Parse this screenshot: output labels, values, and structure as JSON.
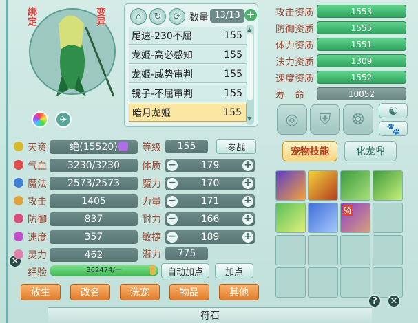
{
  "portrait": {
    "tag_left": "绑定",
    "tag_right": "变异"
  },
  "toolbar": {
    "count_label": "数量",
    "count_value": "13/13",
    "add": "+"
  },
  "pet_list": [
    {
      "name": "尾速-230不屈",
      "level": "155"
    },
    {
      "name": "龙姬-高必感知",
      "level": "155"
    },
    {
      "name": "龙姬-威势审判",
      "level": "155"
    },
    {
      "name": "镜子-不屈审判",
      "level": "155"
    },
    {
      "name": "暗月龙姬",
      "level": "155",
      "selected": true
    }
  ],
  "aptitudes": [
    {
      "label": "攻击资质",
      "value": "1553"
    },
    {
      "label": "防御资质",
      "value": "1555"
    },
    {
      "label": "体力资质",
      "value": "1551"
    },
    {
      "label": "法力资质",
      "value": "1309"
    },
    {
      "label": "速度资质",
      "value": "1552"
    },
    {
      "label": "寿　命",
      "value": "10052"
    }
  ],
  "tabs": {
    "skills": "宠物技能",
    "dragon": "化龙鼎"
  },
  "left_stats": [
    {
      "label": "天资",
      "value": "绝(15520)",
      "color": "#d8b92a"
    },
    {
      "label": "气血",
      "value": "3230/3230",
      "color": "#e04b4b"
    },
    {
      "label": "魔法",
      "value": "2573/2573",
      "color": "#3f7fd6"
    },
    {
      "label": "攻击",
      "value": "1405",
      "color": "#e0a33a"
    },
    {
      "label": "防御",
      "value": "837",
      "color": "#d84f7a"
    },
    {
      "label": "速度",
      "value": "357",
      "color": "#c24fc9"
    },
    {
      "label": "灵力",
      "value": "462",
      "color": "#e07fa9"
    }
  ],
  "level": {
    "label": "等级",
    "value": "155",
    "button": "参战"
  },
  "attrs": [
    {
      "label": "体质",
      "value": "179"
    },
    {
      "label": "魔力",
      "value": "170"
    },
    {
      "label": "力量",
      "value": "171"
    },
    {
      "label": "耐力",
      "value": "166"
    },
    {
      "label": "敏捷",
      "value": "189"
    }
  ],
  "potential": {
    "label": "潜力",
    "value": "775"
  },
  "exp": {
    "label": "经验",
    "value": "362474/一",
    "fraction": 1.0
  },
  "buttons": {
    "auto": "自动加点",
    "add": "加点"
  },
  "bottom_buttons": [
    "放生",
    "改名",
    "洗宠",
    "物品",
    "其他"
  ],
  "bottom_label": "符石",
  "skill_badge": "骑"
}
